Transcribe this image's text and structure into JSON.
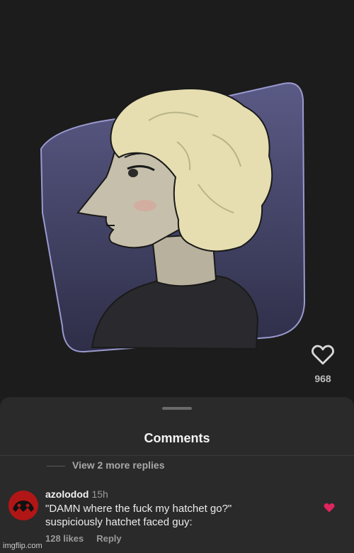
{
  "post": {
    "like_count": "968",
    "colors": {
      "panel": "#4a4a72",
      "hair": "#e6deb0",
      "skin": "#c6bfab",
      "sweater": "#2a2a2e"
    }
  },
  "comments_sheet": {
    "title": "Comments",
    "view_replies": "View 2 more replies",
    "comment": {
      "username": "azolodod",
      "time": "15h",
      "text_line1": "\"DAMN where the fuck my hatchet go?\"",
      "text_line2": "suspiciously hatchet faced guy:",
      "likes": "128 likes",
      "reply": "Reply",
      "heart_color": "#e0245e"
    }
  },
  "watermark": "imgflip.com"
}
